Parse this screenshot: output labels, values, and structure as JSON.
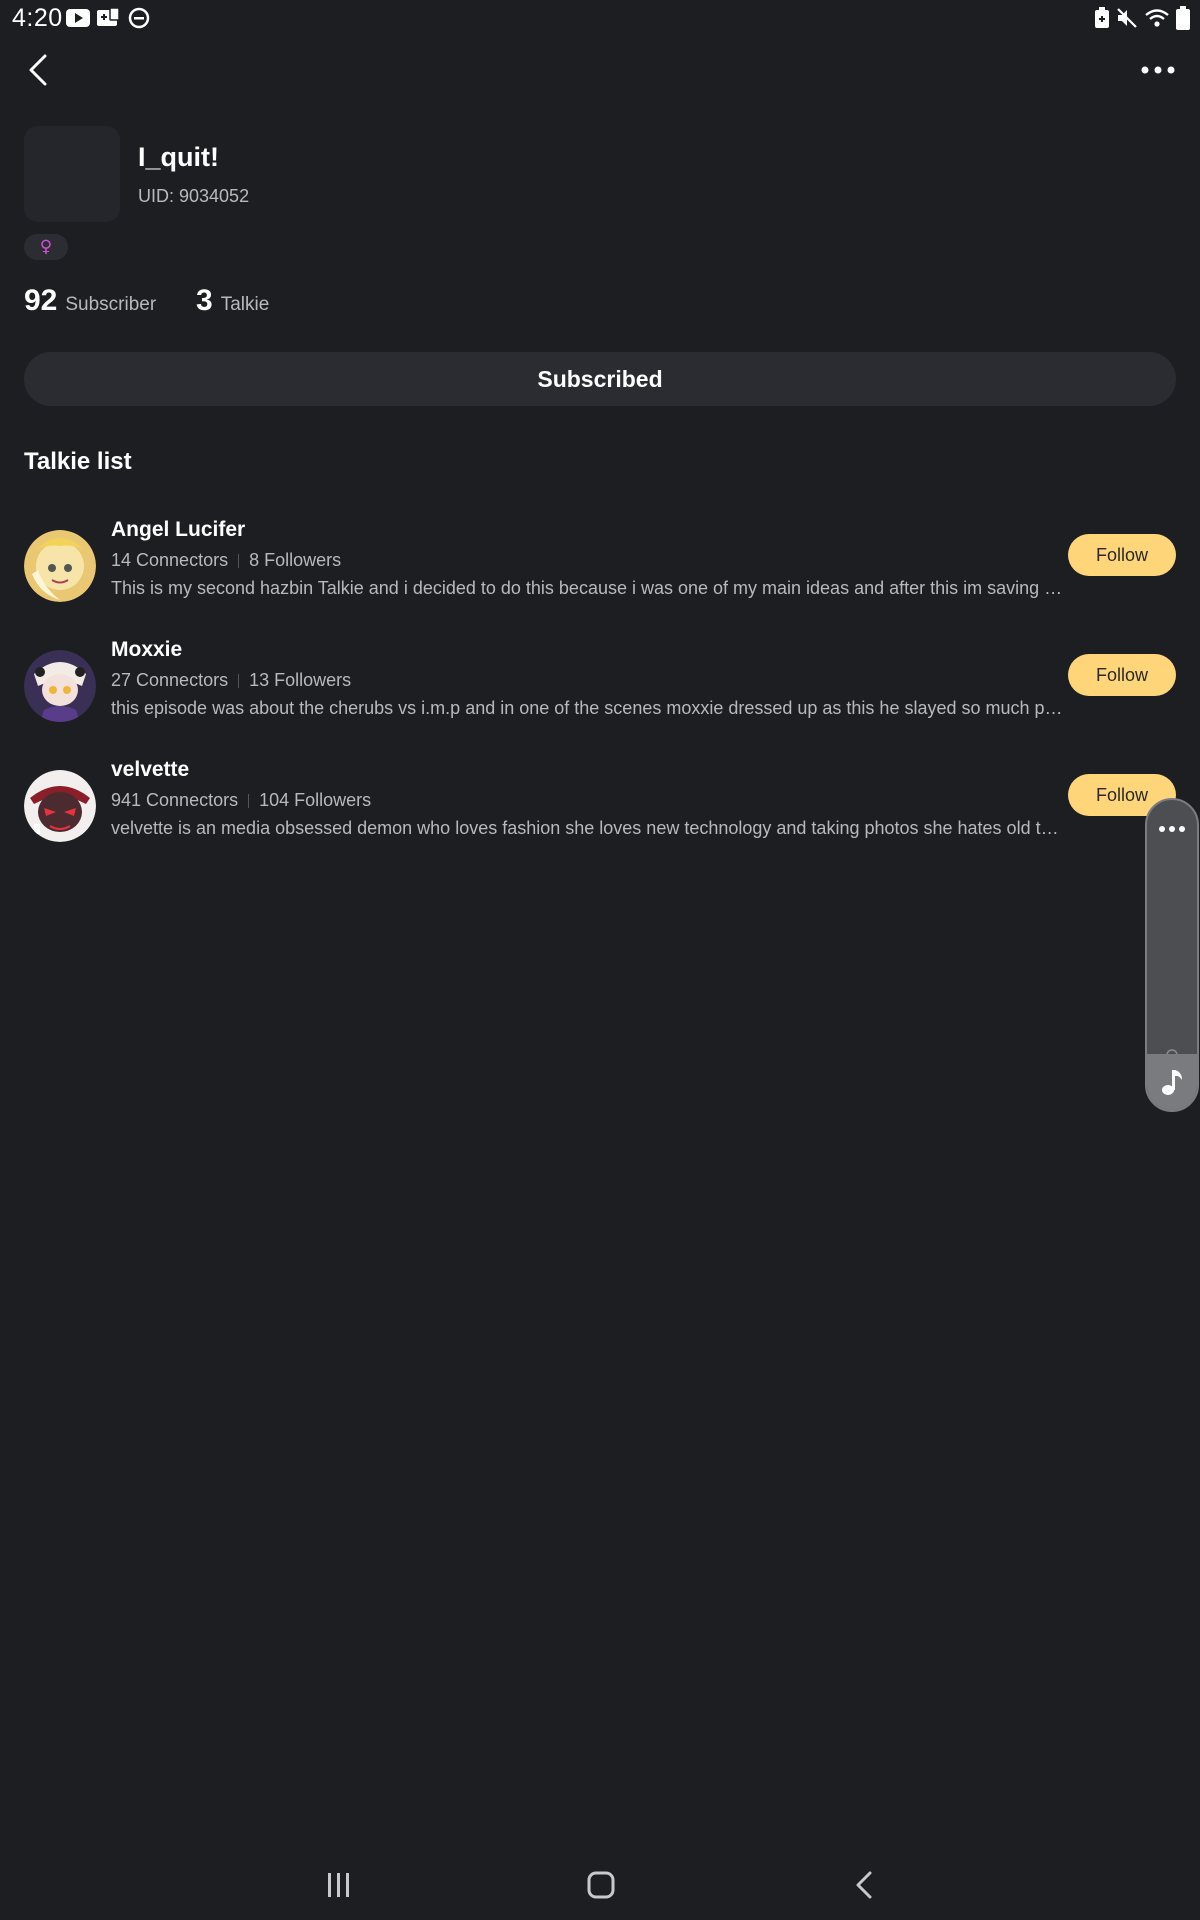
{
  "status_bar": {
    "time": "4:20",
    "left_icons": [
      "youtube-icon",
      "wallet-icon",
      "do-not-disturb-icon"
    ],
    "right_icons": [
      "battery-saver-icon",
      "mute-icon",
      "wifi-icon",
      "battery-icon"
    ]
  },
  "header": {
    "back_icon": "chevron-left-icon",
    "more_icon": "more-horizontal-icon"
  },
  "profile": {
    "name": "I_quit!",
    "uid": "UID: 9034052",
    "gender_symbol": "♀",
    "stats": [
      {
        "value": "92",
        "label": "Subscriber"
      },
      {
        "value": "3",
        "label": "Talkie"
      }
    ],
    "subscribe_label": "Subscribed"
  },
  "talkie_list": {
    "title": "Talkie list",
    "items": [
      {
        "name": "Angel Lucifer",
        "connectors": "14 Connectors",
        "followers": "8 Followers",
        "description": "This is my second hazbin Talkie and i decided to do this because i was one of my main ideas and after this im saving up for more things and i hope you enjoy",
        "follow_label": "Follow"
      },
      {
        "name": "Moxxie",
        "connectors": "27 Connectors",
        "followers": "13 Followers",
        "description": "this episode was about the cherubs vs i.m.p and in one of the scenes moxxie dressed up as this he slayed so much people and i loved it",
        "follow_label": "Follow"
      },
      {
        "name": "velvette",
        "connectors": "941 Connectors",
        "followers": "104 Followers",
        "description": "velvette is an media obsessed demon who loves fashion she loves new technology and taking photos she hates old technology",
        "follow_label": "Follow"
      }
    ]
  },
  "side_widget": {
    "top_icon": "more-horizontal-icon",
    "bottom_icon": "music-note-icon"
  },
  "nav_bar": {
    "icons": [
      "recent-apps-icon",
      "home-icon",
      "back-icon"
    ]
  },
  "colors": {
    "background": "#1d1e22",
    "surface": "#2b2c31",
    "accent_follow": "#ffd57a",
    "text_primary": "#ffffff",
    "text_secondary": "#b8b9bd",
    "gender_pink": "#d44fd4"
  }
}
